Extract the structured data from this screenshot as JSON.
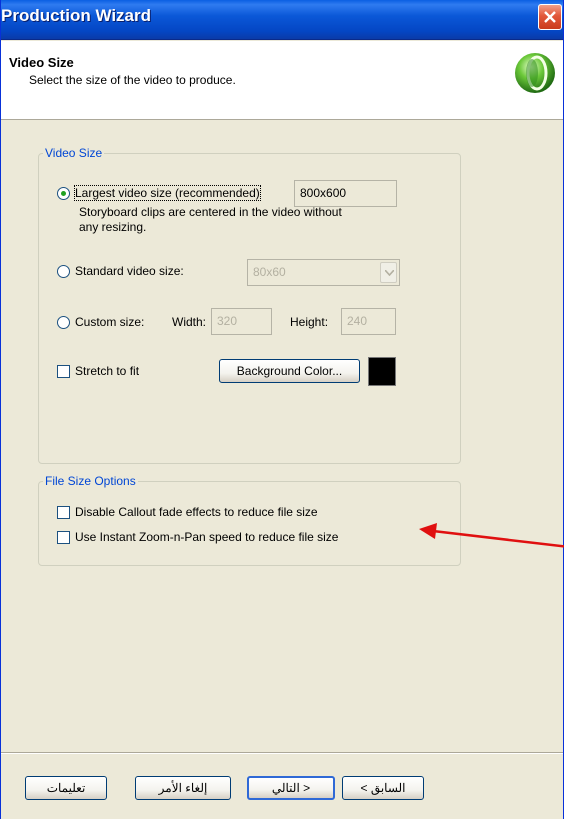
{
  "window": {
    "title": "Production Wizard"
  },
  "header": {
    "title": "Video Size",
    "subtitle": "Select the size of the video to produce.",
    "logo_icon": "green-orb-icon"
  },
  "video_size": {
    "legend": "Video Size",
    "largest": {
      "label": "Largest video size (recommended)",
      "selected": true,
      "value": "800x600",
      "description_line1": "Storyboard clips are centered in the video without",
      "description_line2": "any resizing."
    },
    "standard": {
      "label": "Standard video size:",
      "selected": false,
      "value": "80x60"
    },
    "custom": {
      "label": "Custom size:",
      "selected": false,
      "width_label": "Width:",
      "width_value": "320",
      "height_label": "Height:",
      "height_value": "240"
    },
    "stretch": {
      "label": "Stretch to fit",
      "checked": false
    },
    "background_button": "Background Color...",
    "background_color": "#000000"
  },
  "file_size": {
    "legend": "File Size Options",
    "options": [
      {
        "label": "Disable Callout fade effects to reduce file size",
        "checked": false
      },
      {
        "label": "Use Instant Zoom-n-Pan speed to reduce file size",
        "checked": false
      }
    ]
  },
  "annotation": {
    "arrow_color": "#e01010"
  },
  "footer": {
    "back": "< السابق",
    "next": "التالي >",
    "cancel": "إلغاء الأمر",
    "help": "تعليمات"
  },
  "colors": {
    "titlebar": "#0b58d8",
    "legend": "#0046d5",
    "dialog_bg": "#ece9d8"
  }
}
